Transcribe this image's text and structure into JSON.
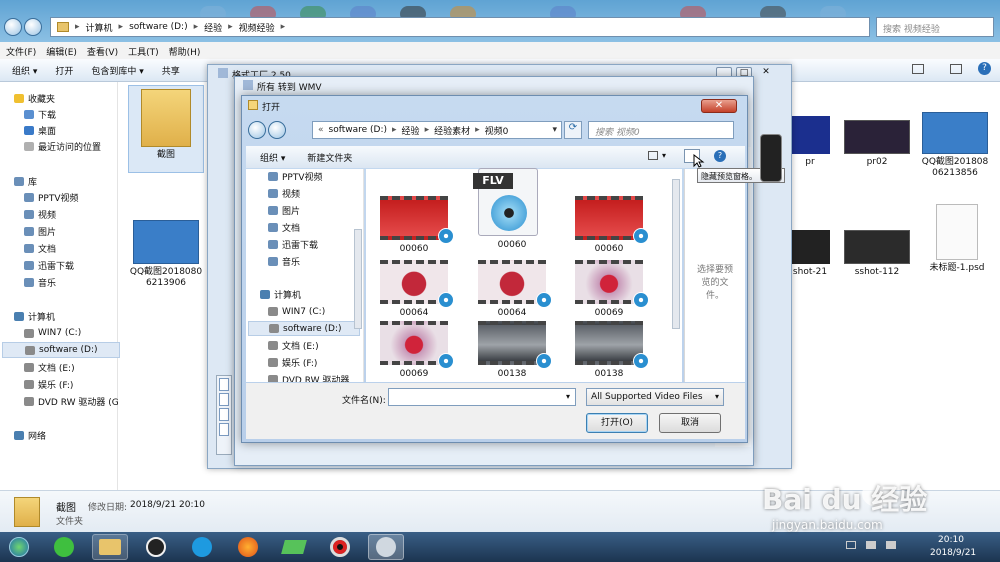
{
  "explorer": {
    "breadcrumb": [
      "计算机",
      "software (D:)",
      "经验",
      "视频经验"
    ],
    "search_placeholder": "搜索 视频经验",
    "menu": [
      "文件(F)",
      "编辑(E)",
      "查看(V)",
      "工具(T)",
      "帮助(H)"
    ],
    "toolbar": {
      "organize": "组织 ▾",
      "open": "打开",
      "include": "包含到库中 ▾",
      "share": "共享"
    },
    "nav": {
      "favorites": "收藏夹",
      "fav_items": [
        "下载",
        "桌面",
        "最近访问的位置"
      ],
      "libraries": "库",
      "lib_items": [
        "PPTV视频",
        "视频",
        "图片",
        "文档",
        "迅雷下载",
        "音乐"
      ],
      "computer": "计算机",
      "drives": [
        "WIN7 (C:)",
        "software (D:)",
        "文档 (E:)",
        "娱乐 (F:)",
        "DVD RW 驱动器 (G"
      ],
      "network": "网络"
    },
    "files": [
      {
        "name": "截图"
      },
      {
        "name": "QQ截图20180806213906"
      },
      {
        "name": "pr"
      },
      {
        "name": "pr02"
      },
      {
        "name": "QQ截图20180806213856"
      },
      {
        "name": "shot-21"
      },
      {
        "name": "sshot-112"
      },
      {
        "name": "未标题-1.psd"
      }
    ],
    "status": {
      "name": "截图",
      "modified_label": "修改日期:",
      "modified": "2018/9/21 20:10",
      "type": "文件夹"
    }
  },
  "geshi_window": {
    "title": "格式工厂 2.50"
  },
  "wmv_window": {
    "title": "所有 转到 WMV"
  },
  "open_dialog": {
    "title": "打开",
    "breadcrumb": [
      "software (D:)",
      "经验",
      "经验素材",
      "视频0"
    ],
    "search_placeholder": "搜索 视频0",
    "organize": "组织 ▾",
    "new_folder": "新建文件夹",
    "tooltip": "隐藏预览窗格。",
    "left_items": [
      "PPTV视频",
      "视频",
      "图片",
      "文档",
      "迅雷下载",
      "音乐",
      "计算机",
      "WIN7 (C:)",
      "software (D:)",
      "文档 (E:)",
      "娱乐 (F:)",
      "DVD RW 驱动器"
    ],
    "files": [
      {
        "name": "00060",
        "kind": "red"
      },
      {
        "name": "00060",
        "kind": "flv"
      },
      {
        "name": "00060",
        "kind": "red"
      },
      {
        "name": "00064",
        "kind": "pink"
      },
      {
        "name": "00064",
        "kind": "pink"
      },
      {
        "name": "00069",
        "kind": "flower"
      },
      {
        "name": "00069",
        "kind": "flower"
      },
      {
        "name": "00138",
        "kind": "car"
      },
      {
        "name": "00138",
        "kind": "car"
      }
    ],
    "flv_label": "FLV",
    "preview_text": "选择要预览的文件。",
    "filename_label": "文件名(N):",
    "filename_value": "",
    "filter": "All Supported Video Files",
    "open_button": "打开(O)",
    "cancel_button": "取消"
  },
  "taskbar": {
    "time": "20:10",
    "date": "2018/9/21"
  },
  "watermark": {
    "brand": "Bai du 经验",
    "url": "jingyan.baidu.com"
  }
}
